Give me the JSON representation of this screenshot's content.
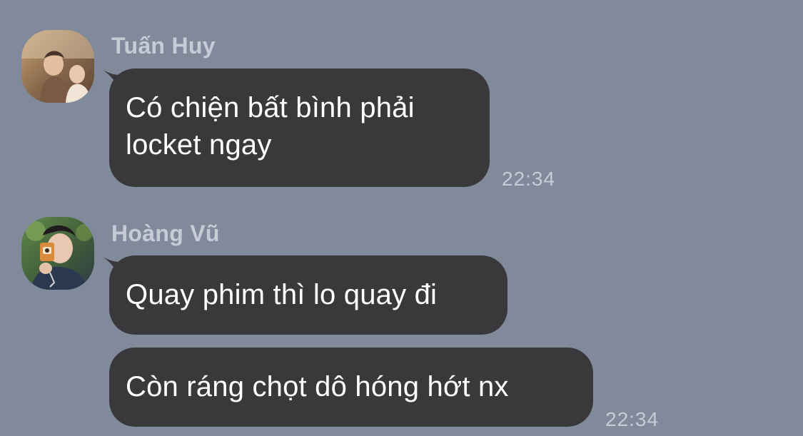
{
  "messages": [
    {
      "sender": "Tuấn Huy",
      "avatar": "avatar-photo-tuan-huy",
      "bubbles": [
        {
          "text": "Có chiện bất bình phải\nlocket ngay"
        }
      ],
      "time": "22:34"
    },
    {
      "sender": "Hoàng Vũ",
      "avatar": "avatar-photo-hoang-vu",
      "bubbles": [
        {
          "text": "Quay phim thì lo quay đi"
        },
        {
          "text": "Còn ráng chọt dô hóng hớt nx"
        }
      ],
      "time": "22:34"
    }
  ],
  "colors": {
    "background": "#818a9b",
    "bubble": "#39393b",
    "meta_text": "#c6cbd6",
    "message_text": "#ffffff"
  }
}
